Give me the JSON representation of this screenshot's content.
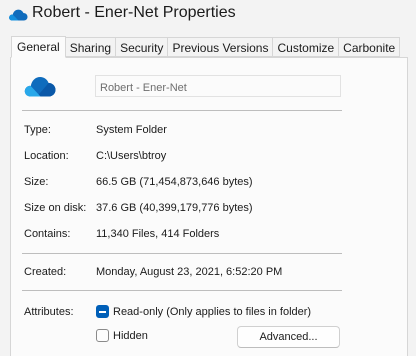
{
  "window": {
    "title": "Robert - Ener-Net Properties",
    "icon": "onedrive-cloud-icon",
    "accent_color": "#005fb8"
  },
  "tabs": [
    {
      "label": "General",
      "active": true
    },
    {
      "label": "Sharing",
      "active": false
    },
    {
      "label": "Security",
      "active": false
    },
    {
      "label": "Previous Versions",
      "active": false
    },
    {
      "label": "Customize",
      "active": false
    },
    {
      "label": "Carbonite",
      "active": false
    }
  ],
  "general": {
    "folder_icon": "onedrive-cloud-icon",
    "name_value": "Robert - Ener-Net",
    "type_label": "Type:",
    "type_value": "System Folder",
    "location_label": "Location:",
    "location_value": "C:\\Users\\btroy",
    "size_label": "Size:",
    "size_value": "66.5 GB (71,454,873,646 bytes)",
    "size_on_disk_label": "Size on disk:",
    "size_on_disk_value": "37.6 GB (40,399,179,776 bytes)",
    "contains_label": "Contains:",
    "contains_value": "11,340 Files, 414 Folders",
    "created_label": "Created:",
    "created_value": "Monday, August 23, 2021, 6:52:20 PM",
    "attributes_label": "Attributes:",
    "readonly_label": "Read-only (Only applies to files in folder)",
    "readonly_state": "indeterminate",
    "hidden_label": "Hidden",
    "hidden_state": "unchecked",
    "advanced_button": "Advanced..."
  }
}
